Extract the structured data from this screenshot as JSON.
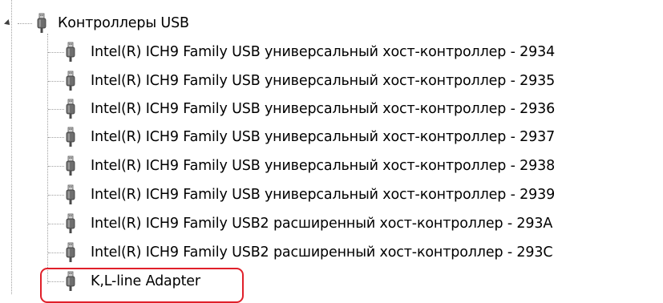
{
  "tree": {
    "parent": {
      "label": "Контроллеры USB",
      "icon": "usb-plug-icon"
    },
    "children": [
      {
        "label": "Intel(R) ICH9 Family USB универсальный хост-контроллер  - 2934",
        "icon": "usb-plug-icon"
      },
      {
        "label": "Intel(R) ICH9 Family USB универсальный хост-контроллер  - 2935",
        "icon": "usb-plug-icon"
      },
      {
        "label": "Intel(R) ICH9 Family USB универсальный хост-контроллер  - 2936",
        "icon": "usb-plug-icon"
      },
      {
        "label": "Intel(R) ICH9 Family USB универсальный хост-контроллер  - 2937",
        "icon": "usb-plug-icon"
      },
      {
        "label": "Intel(R) ICH9 Family USB универсальный хост-контроллер  - 2938",
        "icon": "usb-plug-icon"
      },
      {
        "label": "Intel(R) ICH9 Family USB универсальный хост-контроллер  - 2939",
        "icon": "usb-plug-icon"
      },
      {
        "label": "Intel(R) ICH9 Family USB2 расширенный хост-контроллер  - 293A",
        "icon": "usb-plug-icon"
      },
      {
        "label": "Intel(R) ICH9 Family USB2 расширенный хост-контроллер  - 293C",
        "icon": "usb-plug-icon"
      },
      {
        "label": "K,L-line Adapter",
        "icon": "usb-plug-icon"
      }
    ]
  },
  "colors": {
    "highlight": "#e0202a",
    "tree_lines": "#a0a0a0",
    "icon_dark": "#4a4a4a"
  }
}
